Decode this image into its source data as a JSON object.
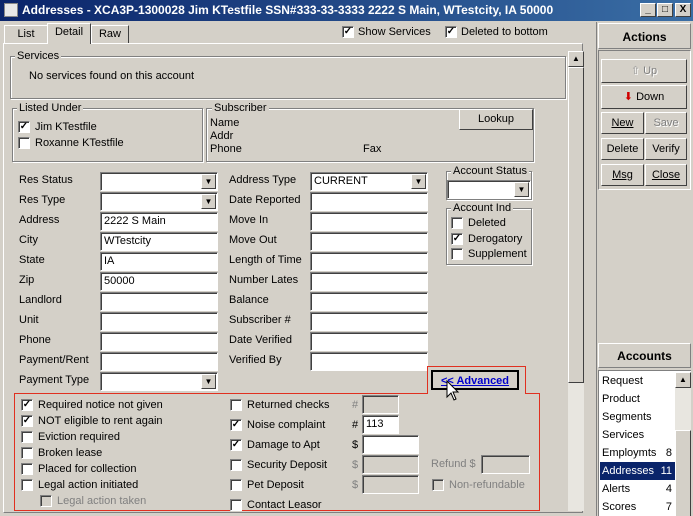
{
  "window": {
    "title": "Addresses - XCA3P-1300028  Jim KTestfile  SSN#333-33-3333  2222 S Main, WTestcity, IA 50000",
    "minimize": "_",
    "restore": "□",
    "close": "X"
  },
  "tabs": [
    {
      "label": "List"
    },
    {
      "label": "Detail"
    },
    {
      "label": "Raw"
    }
  ],
  "options": {
    "show_services": {
      "label": "Show Services",
      "checked": "✓"
    },
    "deleted_to_bottom": {
      "label": "Deleted to bottom",
      "checked": "✓"
    }
  },
  "services": {
    "title": "Services",
    "message": "No services found on this account"
  },
  "listed_under": {
    "title": "Listed Under",
    "items": [
      {
        "label": "Jim KTestfile",
        "checked": "✓"
      },
      {
        "label": "Roxanne KTestfile",
        "checked": ""
      }
    ]
  },
  "subscriber": {
    "title": "Subscriber",
    "name_label": "Name",
    "addr_label": "Addr",
    "phone_label": "Phone",
    "fax_label": "Fax",
    "lookup": "Lookup"
  },
  "form_left": [
    {
      "label": "Res Status",
      "value": "",
      "dropdown": true
    },
    {
      "label": "Res Type",
      "value": "",
      "dropdown": true
    },
    {
      "label": "Address",
      "value": "2222 S Main"
    },
    {
      "label": "City",
      "value": "WTestcity"
    },
    {
      "label": "State",
      "value": "IA"
    },
    {
      "label": "Zip",
      "value": "50000"
    },
    {
      "label": "Landlord",
      "value": ""
    },
    {
      "label": "Unit",
      "value": ""
    },
    {
      "label": "Phone",
      "value": ""
    },
    {
      "label": "Payment/Rent",
      "value": ""
    },
    {
      "label": "Payment Type",
      "value": "",
      "dropdown": true
    }
  ],
  "form_mid": [
    {
      "label": "Address Type",
      "value": "CURRENT",
      "dropdown": true
    },
    {
      "label": "Date Reported",
      "value": ""
    },
    {
      "label": "Move In",
      "value": ""
    },
    {
      "label": "Move Out",
      "value": ""
    },
    {
      "label": "Length of Time",
      "value": ""
    },
    {
      "label": "Number Lates",
      "value": ""
    },
    {
      "label": "Balance",
      "value": ""
    },
    {
      "label": "Subscriber #",
      "value": ""
    },
    {
      "label": "Date Verified",
      "value": ""
    },
    {
      "label": "Verified By",
      "value": ""
    }
  ],
  "account_status": {
    "title": "Account Status",
    "value": ""
  },
  "account_ind": {
    "title": "Account Ind",
    "items": [
      {
        "label": "Deleted",
        "checked": ""
      },
      {
        "label": "Derogatory",
        "checked": "✓"
      },
      {
        "label": "Supplement",
        "checked": ""
      }
    ]
  },
  "advanced_button": "<< Advanced",
  "advanced": {
    "col1": [
      {
        "label": "Required notice not given",
        "checked": "✓"
      },
      {
        "label": "NOT eligible to rent again",
        "checked": "✓"
      },
      {
        "label": "Eviction required",
        "checked": ""
      },
      {
        "label": "Broken lease",
        "checked": ""
      },
      {
        "label": "Placed for collection",
        "checked": ""
      },
      {
        "label": "Legal action initiated",
        "checked": ""
      },
      {
        "label": "Legal action taken",
        "checked": "",
        "disabled": true
      }
    ],
    "col2": [
      {
        "label": "Returned checks",
        "checked": "",
        "prefix": "#",
        "value": ""
      },
      {
        "label": "Noise complaint",
        "checked": "✓",
        "prefix": "#",
        "value": "113"
      },
      {
        "label": "Damage to Apt",
        "checked": "✓",
        "prefix": "$",
        "value": ""
      },
      {
        "label": "Security Deposit",
        "checked": "",
        "prefix": "$",
        "value": ""
      },
      {
        "label": "Pet Deposit",
        "checked": "",
        "prefix": "$",
        "value": ""
      },
      {
        "label": "Contact Leasor",
        "checked": ""
      }
    ],
    "refund_label": "Refund $",
    "refund_value": "",
    "nonrefundable_label": "Non-refundable"
  },
  "actions": {
    "title": "Actions",
    "up": "Up",
    "down": "Down",
    "new": "New",
    "save": "Save",
    "delete": "Delete",
    "verify": "Verify",
    "msg": "Msg",
    "close": "Close"
  },
  "accounts": {
    "title": "Accounts",
    "items": [
      {
        "label": "Request",
        "count": ""
      },
      {
        "label": "Product",
        "count": ""
      },
      {
        "label": "Segments",
        "count": ""
      },
      {
        "label": "Services",
        "count": ""
      },
      {
        "label": "Employmts",
        "count": "8"
      },
      {
        "label": "Addresses",
        "count": "11"
      },
      {
        "label": "Alerts",
        "count": "4"
      },
      {
        "label": "Scores",
        "count": "7"
      }
    ]
  },
  "colors": {
    "titlebar": "#0a246a",
    "selection": "#0a246a",
    "advanced_border": "#e03020",
    "down_arrow": "#d00000",
    "link_blue": "#0000cc"
  }
}
